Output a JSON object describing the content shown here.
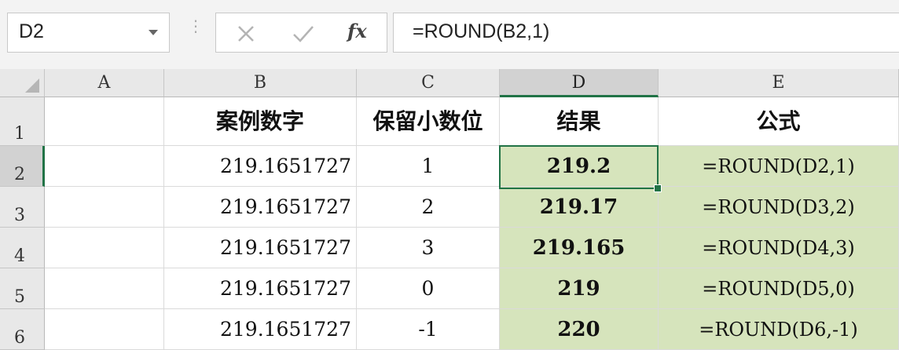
{
  "formula_bar": {
    "name_box": "D2",
    "formula": "=ROUND(B2,1)",
    "fx_label": "fx",
    "separator": "⋮"
  },
  "columns": [
    "A",
    "B",
    "C",
    "D",
    "E"
  ],
  "rows": [
    "1",
    "2",
    "3",
    "4",
    "5",
    "6"
  ],
  "selected_column": "D",
  "selected_row": "2",
  "headers": {
    "B": "案例数字",
    "C": "保留小数位",
    "D": "结果",
    "E": "公式"
  },
  "data_rows": [
    {
      "B": "219.1651727",
      "C": "1",
      "D": "219.2",
      "E": "=ROUND(D2,1)"
    },
    {
      "B": "219.1651727",
      "C": "2",
      "D": "219.17",
      "E": "=ROUND(D3,2)"
    },
    {
      "B": "219.1651727",
      "C": "3",
      "D": "219.165",
      "E": "=ROUND(D4,3)"
    },
    {
      "B": "219.1651727",
      "C": "0",
      "D": "219",
      "E": "=ROUND(D5,0)"
    },
    {
      "B": "219.1651727",
      "C": "-1",
      "D": "220",
      "E": "=ROUND(D6,-1)"
    }
  ],
  "colors": {
    "highlight_fill": "#d6e4bc",
    "selection_border": "#217346"
  }
}
